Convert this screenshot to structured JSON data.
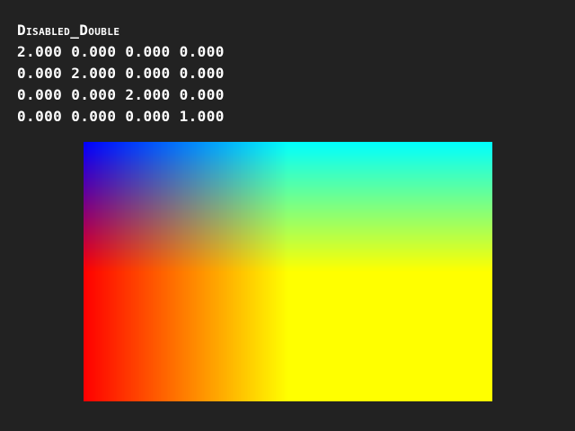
{
  "title": "Disabled_Double",
  "matrix": {
    "rows": [
      "2.000 0.000 0.000 0.000",
      "0.000 2.000 0.000 0.000",
      "0.000 0.000 2.000 0.000",
      "0.000 0.000 0.000 1.000"
    ]
  },
  "colors": {
    "background": "#222222",
    "top_left": "#0000ff",
    "top_right": "#00ffff",
    "bottom_left": "#ff0000",
    "bottom_right": "#ffff00"
  },
  "color_scale": 2.0
}
